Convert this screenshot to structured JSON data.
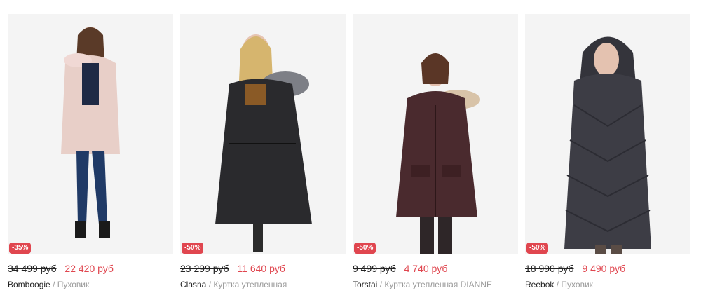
{
  "products": [
    {
      "discount": "-35%",
      "old_price": "34 499 руб",
      "price": "22 420 руб",
      "brand": "Bomboogie",
      "separator": "/",
      "type": "Пуховик",
      "coat_color": "#e8cfc8",
      "accent_color": "#203a66"
    },
    {
      "discount": "-50%",
      "old_price": "23 299 руб",
      "price": "11 640 руб",
      "brand": "Clasna",
      "separator": "/",
      "type": "Куртка утепленная",
      "coat_color": "#2a2a2d",
      "accent_color": "#7d7f86"
    },
    {
      "discount": "-50%",
      "old_price": "9 499 руб",
      "price": "4 740 руб",
      "brand": "Torstai",
      "separator": "/",
      "type": "Куртка утепленная DIANNE",
      "coat_color": "#4a2a2e",
      "accent_color": "#2e2628"
    },
    {
      "discount": "-50%",
      "old_price": "18 990 руб",
      "price": "9 490 руб",
      "brand": "Reebok",
      "separator": "/",
      "type": "Пуховик",
      "coat_color": "#3d3d45",
      "accent_color": "#5a4c45"
    }
  ],
  "colors": {
    "sale_red": "#e0464f",
    "muted_text": "#9a9a9a",
    "photo_bg": "#f4f4f4"
  }
}
